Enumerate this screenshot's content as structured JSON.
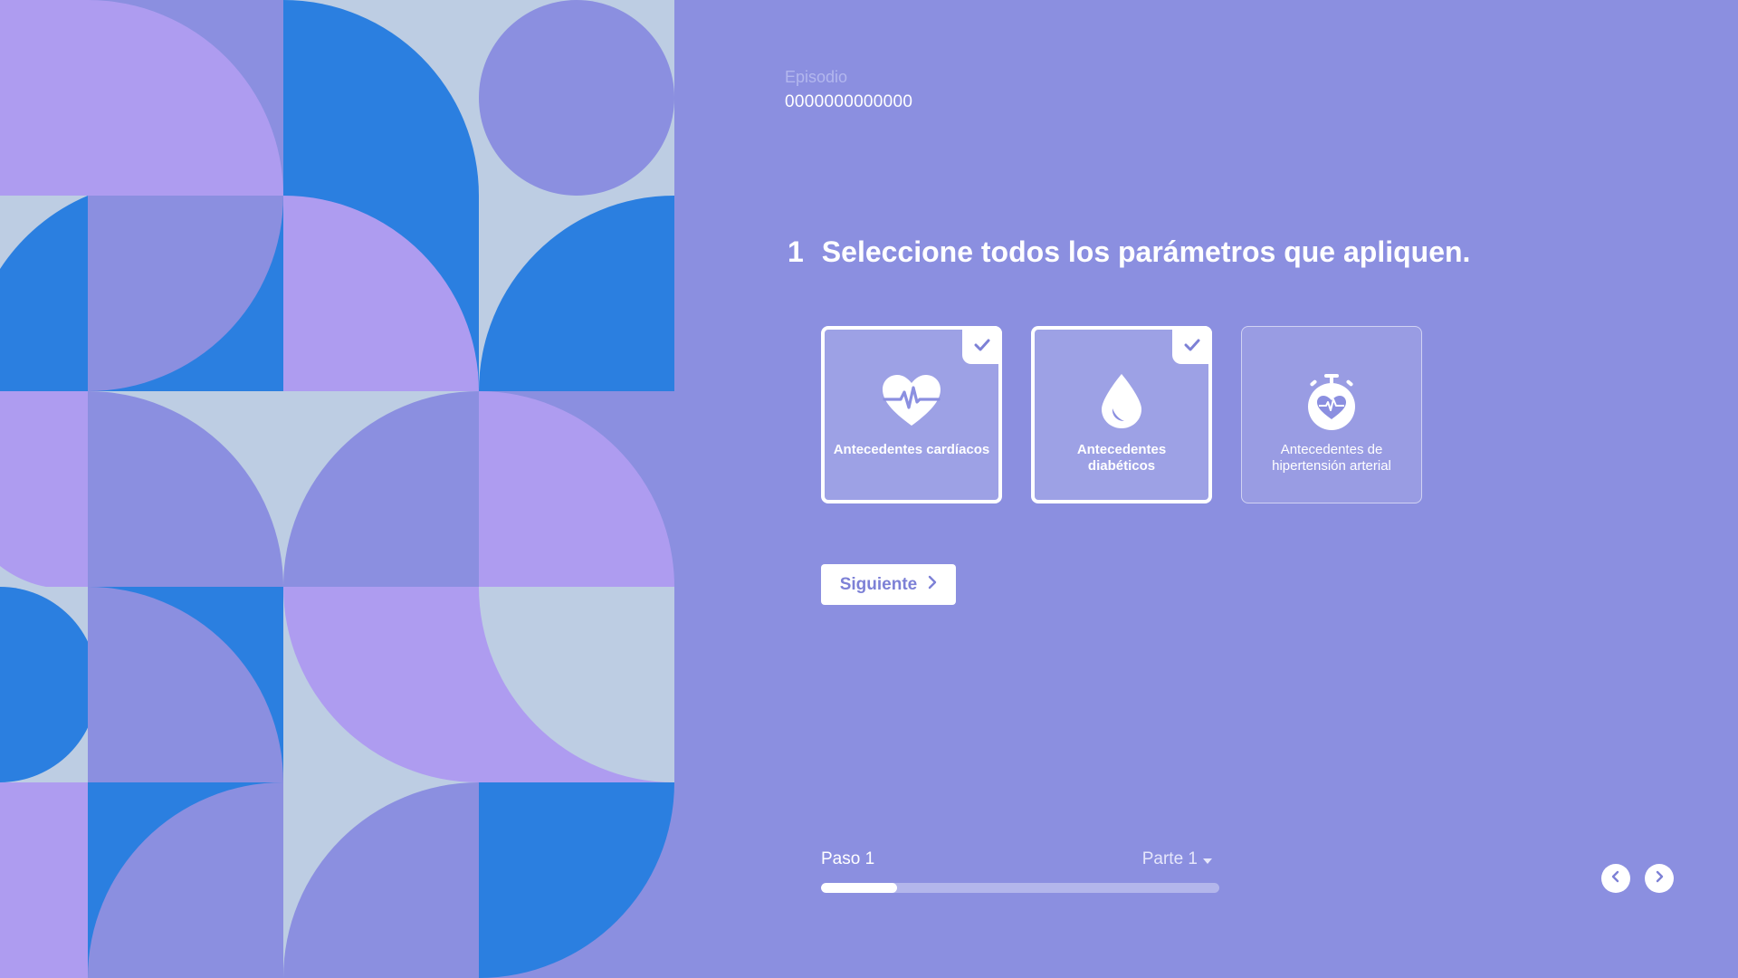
{
  "episode": {
    "label": "Episodio",
    "value": "0000000000000"
  },
  "question": {
    "number": "1",
    "text": "Seleccione todos los parámetros que apliquen."
  },
  "options": [
    {
      "label": "Antecedentes cardíacos",
      "icon": "heart-pulse-icon",
      "selected": true
    },
    {
      "label": "Antecedentes diabéticos",
      "icon": "blood-drop-icon",
      "selected": true
    },
    {
      "label": "Antecedentes de hipertensión arterial",
      "icon": "heart-stopwatch-icon",
      "selected": false
    }
  ],
  "next_button": {
    "label": "Siguiente"
  },
  "progress": {
    "step_label": "Paso 1",
    "part_label": "Parte 1",
    "fraction": 0.19
  },
  "colors": {
    "background": "#8b8fe0",
    "accent": "#7d81d6",
    "art_blue": "#2b7fe0",
    "art_lilac": "#ae9cf0",
    "art_periwinkle": "#8b8fe0",
    "art_pale": "#bdcde3"
  }
}
